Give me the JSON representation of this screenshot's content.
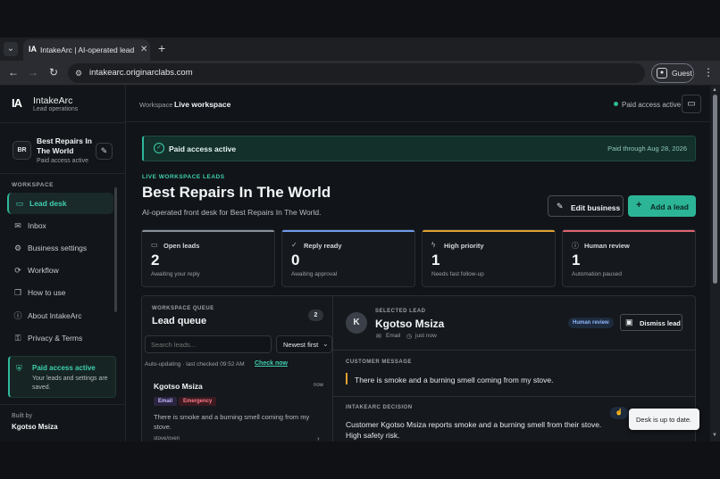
{
  "browser": {
    "tab_title": "IntakeArc | AI-operated lead de",
    "tab_favicon": "IA",
    "url": "intakearc.originarclabs.com",
    "profile_label": "Guest"
  },
  "sidebar": {
    "brand": "IntakeArc",
    "brand_sub": "Lead operations",
    "logo": "IA",
    "business": {
      "initials": "BR",
      "name": "Best Repairs In The World",
      "status": "Paid access active"
    },
    "section_label": "WORKSPACE",
    "items": [
      {
        "label": "Lead desk",
        "icon": "inbox-tray-icon"
      },
      {
        "label": "Inbox",
        "icon": "mail-icon"
      },
      {
        "label": "Business settings",
        "icon": "gear-icon"
      },
      {
        "label": "Workflow",
        "icon": "workflow-icon"
      },
      {
        "label": "How to use",
        "icon": "book-icon"
      },
      {
        "label": "About IntakeArc",
        "icon": "info-icon"
      },
      {
        "label": "Privacy & Terms",
        "icon": "lock-icon"
      }
    ],
    "paid_card": {
      "title": "Paid access active",
      "desc": "Your leads and settings are saved."
    },
    "built_by_label": "Built by",
    "built_by_name": "Kgotso Msiza"
  },
  "header": {
    "crumb_workspace": "Workspace",
    "crumb_current": "Live workspace",
    "status": "Paid access active"
  },
  "banner": {
    "title": "Paid access active",
    "right": "Paid through Aug 28, 2026"
  },
  "page": {
    "eyebrow": "LIVE WORKSPACE LEADS",
    "title": "Best Repairs In The World",
    "subtitle": "AI-operated front desk for Best Repairs In The World.",
    "edit_button": "Edit business",
    "add_button": "Add a lead"
  },
  "stats": [
    {
      "label": "Open leads",
      "value": "2",
      "note": "Awaiting your reply",
      "color": "#8a9098"
    },
    {
      "label": "Reply ready",
      "value": "0",
      "note": "Awaiting approval",
      "color": "#6f9be8"
    },
    {
      "label": "High priority",
      "value": "1",
      "note": "Needs fast follow-up",
      "color": "#e0a132"
    },
    {
      "label": "Human review",
      "value": "1",
      "note": "Automation paused",
      "color": "#e0636f"
    }
  ],
  "queue": {
    "eyebrow": "WORKSPACE QUEUE",
    "title": "Lead queue",
    "count": "2",
    "search_placeholder": "Search leads...",
    "sort": "Newest first",
    "auto_text": "Auto-updating · last checked 09:52 AM",
    "check_now": "Check now",
    "lead": {
      "name": "Kgotso Msiza",
      "time": "now",
      "tags": [
        "Email",
        "Emergency"
      ],
      "preview": "There is smoke and a burning smell coming from my stove.",
      "meta": "stove/oven"
    }
  },
  "detail": {
    "avatar": "K",
    "eyebrow": "SELECTED LEAD",
    "name": "Kgotso Msiza",
    "channel": "Email",
    "time": "just now",
    "badge": "Human review",
    "dismiss": "Dismiss lead",
    "message_label": "CUSTOMER MESSAGE",
    "message": "There is smoke and a burning smell coming from my stove.",
    "decision_label": "INTAKEARC DECISION",
    "decision": "Customer Kgotso Msiza reports smoke and a burning smell from their stove. High safety risk."
  },
  "toast": "Desk is up to date.",
  "colors": {
    "accent": "#2bb596",
    "background": "#111418"
  }
}
